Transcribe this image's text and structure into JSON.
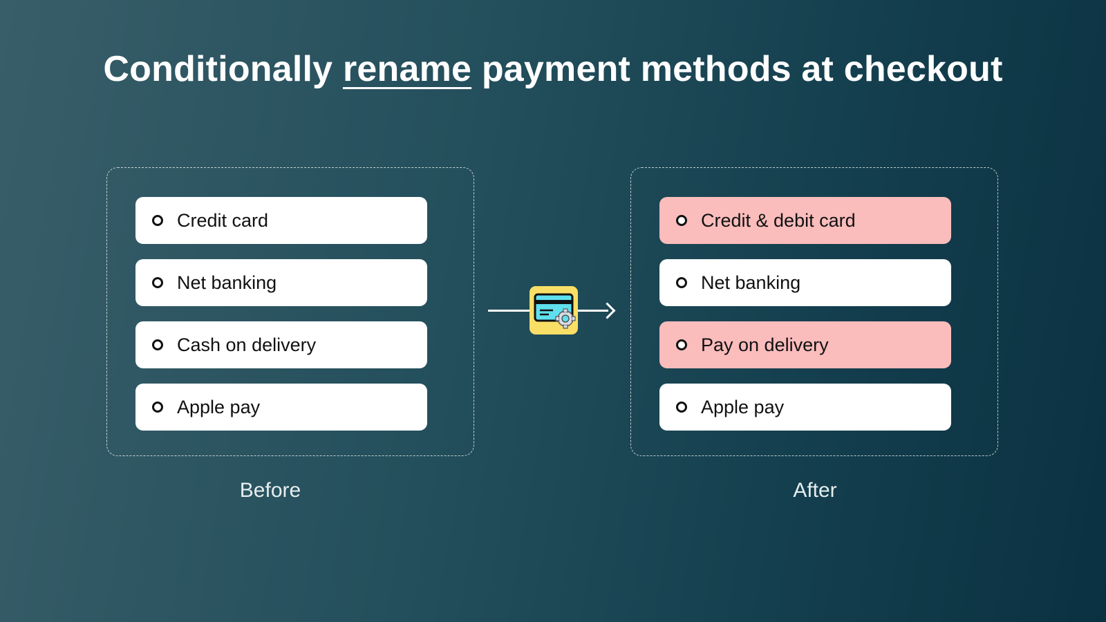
{
  "title": {
    "prefix": "Conditionally ",
    "emphasis": "rename",
    "suffix": " payment methods at checkout"
  },
  "before": {
    "caption": "Before",
    "options": [
      {
        "label": "Credit card",
        "changed": false
      },
      {
        "label": "Net banking",
        "changed": false
      },
      {
        "label": "Cash on delivery",
        "changed": false
      },
      {
        "label": "Apple pay",
        "changed": false
      }
    ]
  },
  "after": {
    "caption": "After",
    "options": [
      {
        "label": "Credit & debit card",
        "changed": true
      },
      {
        "label": "Net banking",
        "changed": false
      },
      {
        "label": "Pay on delivery",
        "changed": true
      },
      {
        "label": "Apple pay",
        "changed": false
      }
    ]
  },
  "connector": {
    "icon": "credit-card-gear-icon"
  },
  "colors": {
    "background_start": "#385e69",
    "background_end": "#0a3141",
    "changed_highlight": "#fbbcbc",
    "badge": "#f9df66",
    "card": "#5ee0ee"
  }
}
